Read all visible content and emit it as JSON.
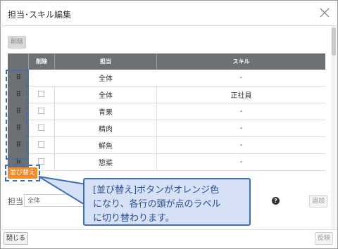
{
  "dialog": {
    "title": "担当･スキル編集",
    "close_icon": "close-icon"
  },
  "toolbar": {
    "delete_label": "削除"
  },
  "table": {
    "headers": [
      "削除",
      "担当",
      "スキル"
    ],
    "rows": [
      {
        "handle": "⠿",
        "tan": "全体",
        "skill": "-"
      },
      {
        "handle": "⠿",
        "tan": "全体",
        "skill": "正社員"
      },
      {
        "handle": "⠿",
        "tan": "青果",
        "skill": "-"
      },
      {
        "handle": "⠿",
        "tan": "精肉",
        "skill": "-"
      },
      {
        "handle": "⠿",
        "tan": "鮮魚",
        "skill": "-"
      },
      {
        "handle": "⠿",
        "tan": "惣菜",
        "skill": "-"
      }
    ]
  },
  "sort_button": {
    "label": "並び替え",
    "color": "#f08c2a"
  },
  "form": {
    "charge_label": "担当",
    "charge_value": "全体",
    "help_icon": "?",
    "add_label": "追加"
  },
  "footer": {
    "close_label": "閉じる",
    "apply_label": "反映"
  },
  "callout": {
    "line1": "[並び替え]ボタンがオレンジ色",
    "line2": "になり、各行の頭が点のラベル",
    "line3": "に切り替わります。"
  },
  "colors": {
    "accent": "#3c6fb4",
    "header": "#6d7075",
    "callout_bg": "#d6e1f6"
  }
}
